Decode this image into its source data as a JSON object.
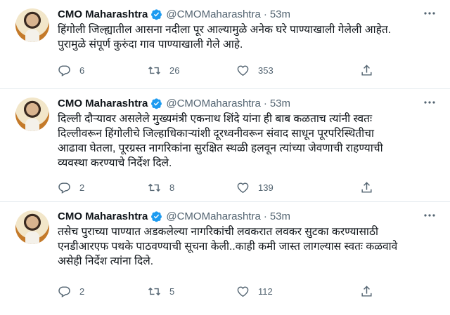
{
  "tweets": [
    {
      "name": "CMO Maharashtra",
      "handle": "@CMOMaharashtra",
      "separator": "·",
      "time": "53m",
      "text": "हिंगोली जिल्ह्यातील आसना नदीला पूर आल्यामुळे अनेक घरे पाण्याखाली गेलेली आहेत.\nपुरामुळे संपूर्ण कुरुंदा गाव पाण्याखाली गेले आहे.",
      "replies": "6",
      "retweets": "26",
      "likes": "353"
    },
    {
      "name": "CMO Maharashtra",
      "handle": "@CMOMaharashtra",
      "separator": "·",
      "time": "53m",
      "text": "दिल्ली दौऱ्यावर असलेले मुख्यमंत्री एकनाथ शिंदे यांना ही बाब कळताच त्यांनी स्वतः\nदिल्लीवरून हिंगोलीचे जिल्हाधिकाऱ्यांशी दूरध्वनीवरून संवाद साधून पूरपरिस्थितीचा\nआढावा घेतला, पूरग्रस्त नागरिकांना सुरक्षित स्थळी हलवून त्यांच्या जेवणाची राहण्याची\nव्यवस्था करण्याचे निर्देश दिले.",
      "replies": "2",
      "retweets": "8",
      "likes": "139"
    },
    {
      "name": "CMO Maharashtra",
      "handle": "@CMOMaharashtra",
      "separator": "·",
      "time": "53m",
      "text": "तसेच पुराच्या पाण्यात अडकलेल्या नागरिकांची लवकरात लवकर सुटका करण्यासाठी\nएनडीआरएफ पथके पाठवण्याची सूचना केली..काही कमी जास्त लागल्यास स्वतः कळवावे\nअसेही निर्देश त्यांना दिले.",
      "replies": "2",
      "retweets": "5",
      "likes": "112"
    }
  ],
  "icons": {
    "verified": "verified-badge-icon",
    "more": "more-icon",
    "reply": "reply-icon",
    "retweet": "retweet-icon",
    "like": "like-icon",
    "share": "share-icon"
  },
  "colors": {
    "verified": "#1d9bf0",
    "muted": "#536471",
    "text": "#0f1419",
    "divider": "#e6ecf0"
  }
}
